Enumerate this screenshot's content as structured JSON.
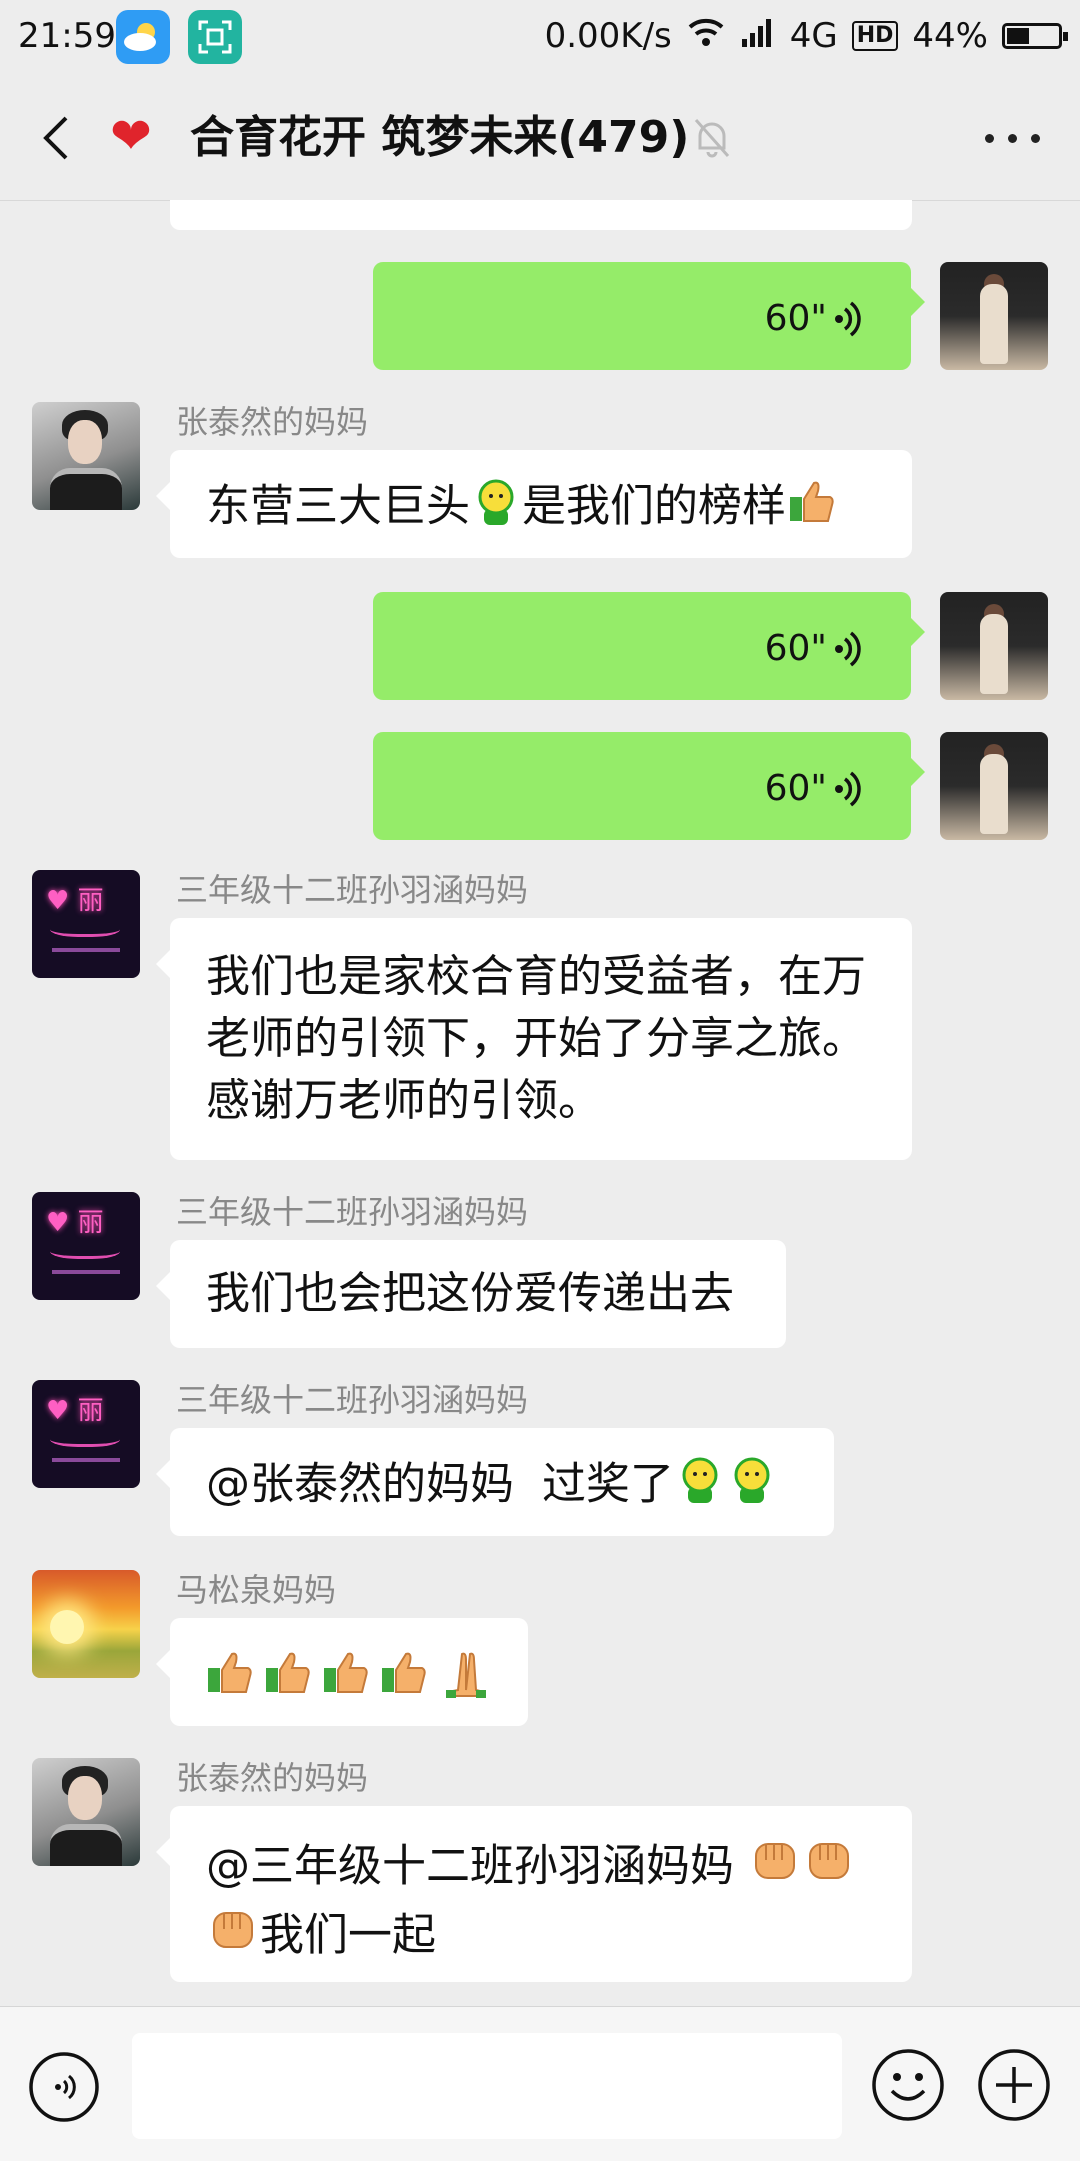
{
  "status_bar": {
    "time": "21:59",
    "network_speed": "0.00K/s",
    "network_type": "4G",
    "hd_badge": "HD",
    "battery": "44%",
    "battery_level": 0.44,
    "apps": [
      "weather-icon",
      "scan-icon"
    ]
  },
  "header": {
    "title": "合育花开 筑梦未来(479)",
    "icons": [
      "back-arrow-icon",
      "heart-icon",
      "mute-bell-icon",
      "more-dots-icon"
    ]
  },
  "messages": [
    {
      "id": "m1",
      "side": "right",
      "type": "voice",
      "duration": "60\""
    },
    {
      "id": "m2",
      "side": "left",
      "sender": "张泰然的妈妈",
      "text_a": "东营三大巨头",
      "text_b": "是我们的榜样"
    },
    {
      "id": "m3",
      "side": "right",
      "type": "voice",
      "duration": "60\""
    },
    {
      "id": "m4",
      "side": "right",
      "type": "voice",
      "duration": "60\""
    },
    {
      "id": "m5",
      "side": "left",
      "sender": "三年级十二班孙羽涵妈妈",
      "lines": [
        "我们也是家校合育的受益者，在万",
        "老师的引领下，开始了分享之旅。",
        "感谢万老师的引领。"
      ]
    },
    {
      "id": "m6",
      "side": "left",
      "sender": "三年级十二班孙羽涵妈妈",
      "text": "我们也会把这份爱传递出去"
    },
    {
      "id": "m7",
      "side": "left",
      "sender": "三年级十二班孙羽涵妈妈",
      "text": "@张泰然的妈妈  过奖了"
    },
    {
      "id": "m8",
      "side": "left",
      "sender": "马松泉妈妈",
      "emojis": [
        "thumbs-up",
        "thumbs-up",
        "thumbs-up",
        "thumbs-up",
        "folded-hands"
      ]
    },
    {
      "id": "m9",
      "side": "left",
      "sender": "张泰然的妈妈",
      "line1": "@三年级十二班孙羽涵妈妈",
      "line2": "我们一起"
    }
  ],
  "input_bar": {
    "icons": [
      "voice-input-icon",
      "emoji-icon",
      "plus-icon"
    ]
  },
  "colors": {
    "background": "#ededed",
    "my_bubble": "#95ec69",
    "their_bubble": "#ffffff",
    "heart": "#e0242c"
  }
}
